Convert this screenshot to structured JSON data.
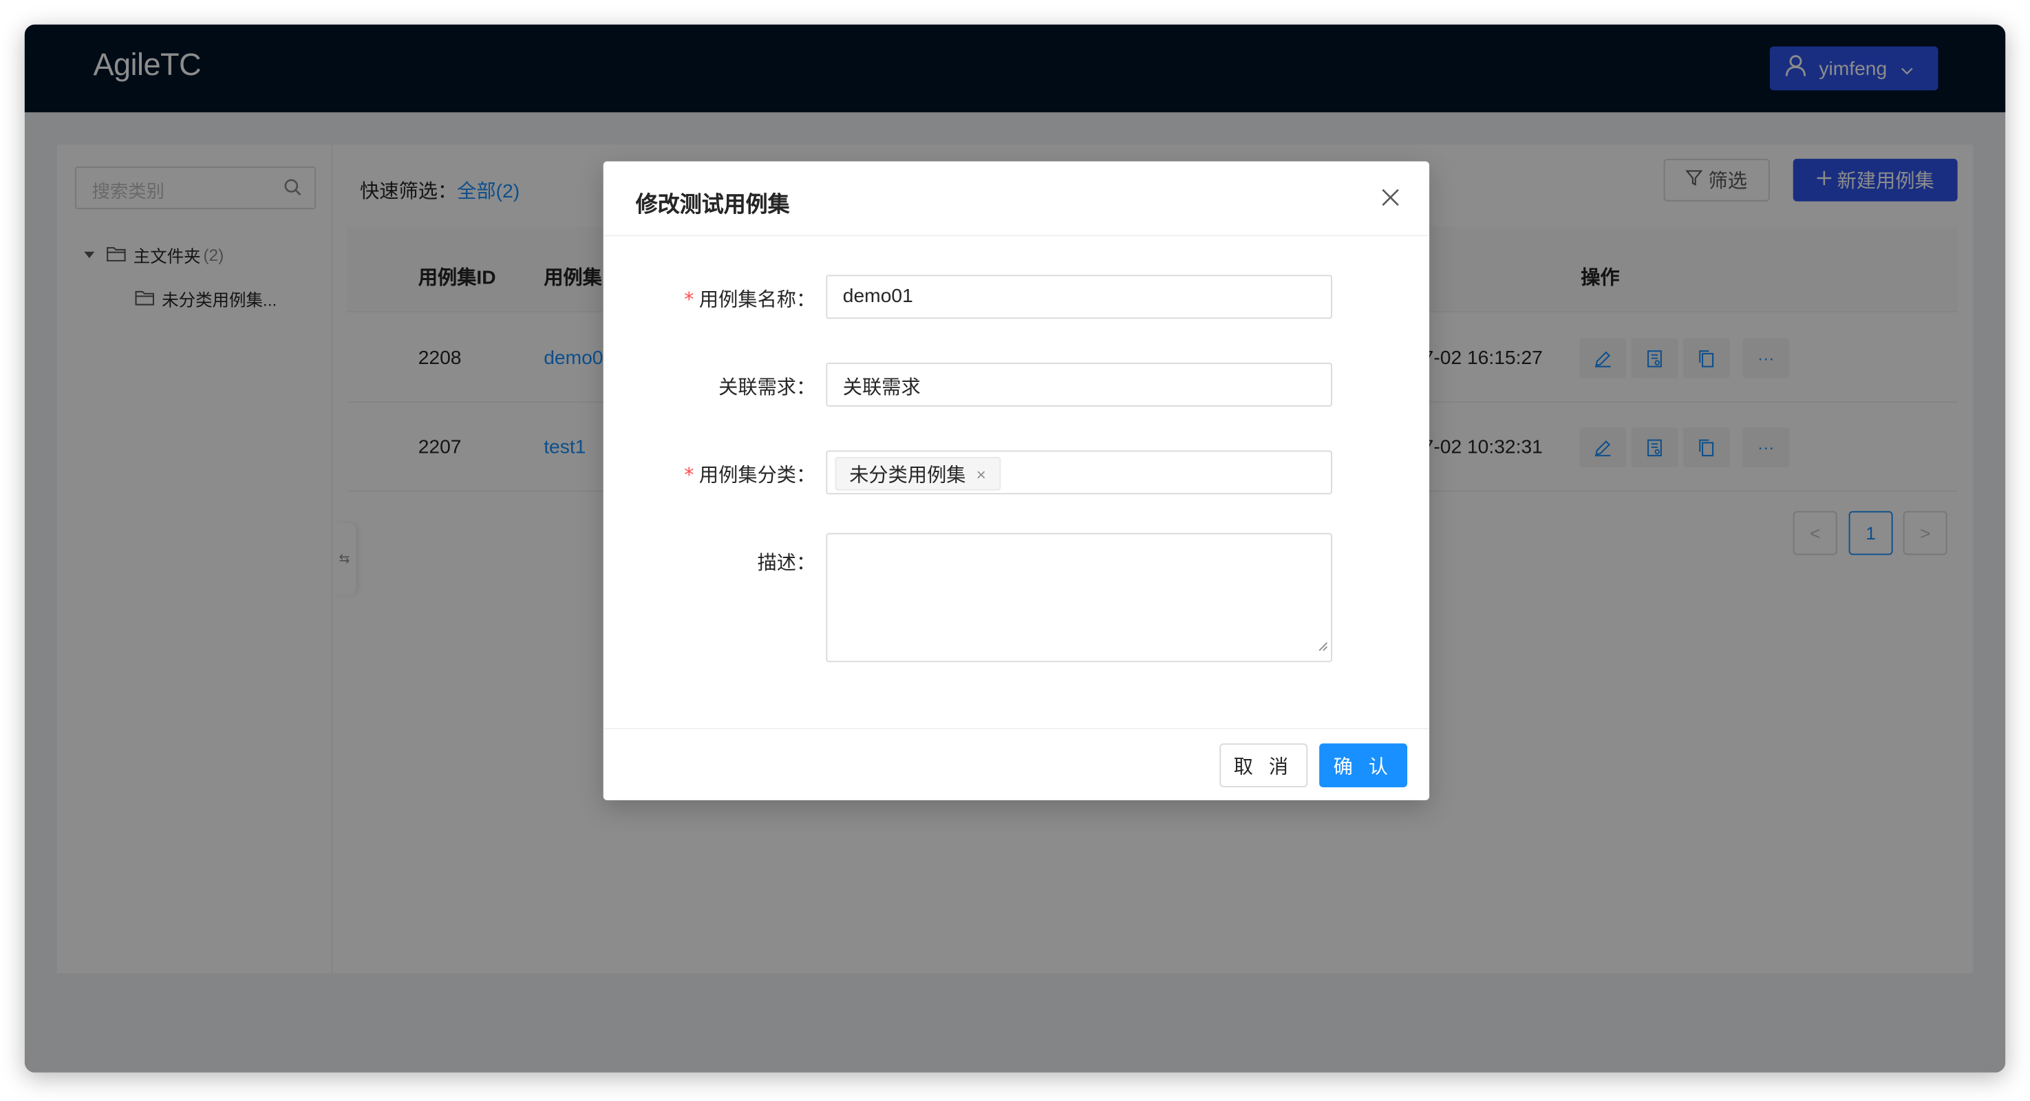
{
  "app": {
    "title": "AgileTC",
    "user": "yimfeng"
  },
  "sidebar": {
    "search_placeholder": "搜索类别",
    "root_label": "主文件夹",
    "root_count": "(2)",
    "child_label": "未分类用例集..."
  },
  "toolbar": {
    "quick_filter_label": "快速筛选：",
    "quick_filter_all": "全部(2)",
    "filter_label": "筛选",
    "new_label": "新建用例集"
  },
  "table": {
    "headers": [
      "用例集ID",
      "用例集",
      "操作"
    ],
    "rows": [
      {
        "id": "2208",
        "name": "demo0",
        "time": "7-02 16:15:27"
      },
      {
        "id": "2207",
        "name": "test1",
        "time": "7-02 10:32:31"
      }
    ],
    "ops_more": "···",
    "pager": {
      "prev": "<",
      "current": "1",
      "next": ">"
    }
  },
  "modal": {
    "title": "修改测试用例集",
    "fields": {
      "name_label": "用例集名称：",
      "name_value": "demo01",
      "req_label": "关联需求：",
      "req_placeholder": "关联需求",
      "category_label": "用例集分类：",
      "category_tag": "未分类用例集",
      "tag_remove": "×",
      "desc_label": "描述："
    },
    "required_mark": "*",
    "cancel_label": "取 消",
    "ok_label": "确 认"
  },
  "colors": {
    "header_bg": "#001529",
    "primary": "#2f54eb",
    "link": "#1890ff",
    "required": "#ff4d4f"
  },
  "icons": [
    "user-icon",
    "chevron-down-icon",
    "search-icon",
    "caret-down-icon",
    "folder-icon",
    "collapse-icon",
    "filter-icon",
    "plus-icon",
    "edit-icon",
    "document-icon",
    "copy-icon",
    "more-icon",
    "close-icon",
    "resize-icon"
  ]
}
